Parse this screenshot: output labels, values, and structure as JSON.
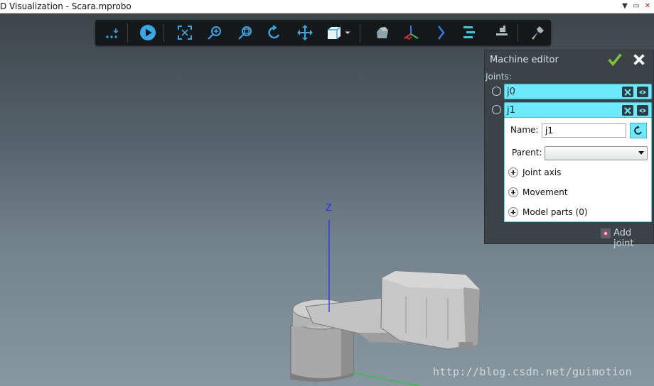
{
  "window": {
    "title": "D Visualization - Scara.mprobo",
    "controls": [
      "minimize-dropdown",
      "restore",
      "close"
    ]
  },
  "toolbar": {
    "buttons": [
      {
        "name": "more-options",
        "icon": "more-icon"
      },
      {
        "name": "play",
        "icon": "play-icon"
      },
      {
        "name": "fit-view",
        "icon": "fit-view-icon"
      },
      {
        "name": "zoom",
        "icon": "zoom-icon"
      },
      {
        "name": "zoom-window",
        "icon": "zoom-window-icon"
      },
      {
        "name": "rotate",
        "icon": "rotate-icon"
      },
      {
        "name": "pan",
        "icon": "pan-icon"
      },
      {
        "name": "view-cube",
        "icon": "cube-icon"
      },
      {
        "name": "view-cube-dropdown",
        "icon": "chevron-down-icon"
      },
      {
        "name": "model",
        "icon": "model-icon"
      },
      {
        "name": "frames",
        "icon": "axes-icon"
      },
      {
        "name": "next",
        "icon": "chevron-right-icon"
      },
      {
        "name": "layers",
        "icon": "layers-icon"
      },
      {
        "name": "machine",
        "icon": "machine-icon"
      },
      {
        "name": "tools",
        "icon": "wrench-icon"
      }
    ]
  },
  "machine_editor": {
    "title": "Machine editor",
    "joints_label": "Joints:",
    "joints": [
      {
        "name": "j0",
        "expanded": false
      },
      {
        "name": "j1",
        "expanded": true
      }
    ],
    "selected": {
      "name_label": "Name:",
      "name_value": "j1",
      "parent_label": "Parent:",
      "parent_value": "",
      "sections": [
        "Joint axis",
        "Movement",
        "Model parts (0)"
      ]
    },
    "add_joint_label": "Add joint"
  },
  "viewport": {
    "axis_label": "Z"
  },
  "watermark": "http://blog.csdn.net/guimotion",
  "colors": {
    "accent": "#6ee8fb",
    "panel": "#3b4347",
    "toolbar_icon": "#3ba7e6",
    "ok": "#7cc53a"
  }
}
